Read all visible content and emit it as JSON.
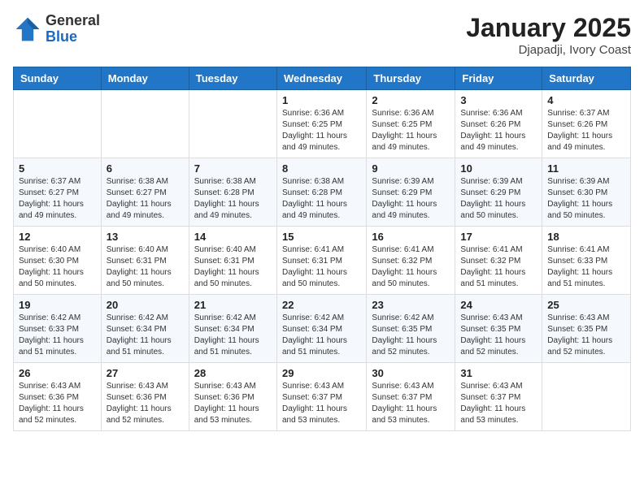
{
  "header": {
    "logo_general": "General",
    "logo_blue": "Blue",
    "month_title": "January 2025",
    "location": "Djapadji, Ivory Coast"
  },
  "weekdays": [
    "Sunday",
    "Monday",
    "Tuesday",
    "Wednesday",
    "Thursday",
    "Friday",
    "Saturday"
  ],
  "weeks": [
    [
      {
        "day": "",
        "info": ""
      },
      {
        "day": "",
        "info": ""
      },
      {
        "day": "",
        "info": ""
      },
      {
        "day": "1",
        "info": "Sunrise: 6:36 AM\nSunset: 6:25 PM\nDaylight: 11 hours and 49 minutes."
      },
      {
        "day": "2",
        "info": "Sunrise: 6:36 AM\nSunset: 6:25 PM\nDaylight: 11 hours and 49 minutes."
      },
      {
        "day": "3",
        "info": "Sunrise: 6:36 AM\nSunset: 6:26 PM\nDaylight: 11 hours and 49 minutes."
      },
      {
        "day": "4",
        "info": "Sunrise: 6:37 AM\nSunset: 6:26 PM\nDaylight: 11 hours and 49 minutes."
      }
    ],
    [
      {
        "day": "5",
        "info": "Sunrise: 6:37 AM\nSunset: 6:27 PM\nDaylight: 11 hours and 49 minutes."
      },
      {
        "day": "6",
        "info": "Sunrise: 6:38 AM\nSunset: 6:27 PM\nDaylight: 11 hours and 49 minutes."
      },
      {
        "day": "7",
        "info": "Sunrise: 6:38 AM\nSunset: 6:28 PM\nDaylight: 11 hours and 49 minutes."
      },
      {
        "day": "8",
        "info": "Sunrise: 6:38 AM\nSunset: 6:28 PM\nDaylight: 11 hours and 49 minutes."
      },
      {
        "day": "9",
        "info": "Sunrise: 6:39 AM\nSunset: 6:29 PM\nDaylight: 11 hours and 49 minutes."
      },
      {
        "day": "10",
        "info": "Sunrise: 6:39 AM\nSunset: 6:29 PM\nDaylight: 11 hours and 50 minutes."
      },
      {
        "day": "11",
        "info": "Sunrise: 6:39 AM\nSunset: 6:30 PM\nDaylight: 11 hours and 50 minutes."
      }
    ],
    [
      {
        "day": "12",
        "info": "Sunrise: 6:40 AM\nSunset: 6:30 PM\nDaylight: 11 hours and 50 minutes."
      },
      {
        "day": "13",
        "info": "Sunrise: 6:40 AM\nSunset: 6:31 PM\nDaylight: 11 hours and 50 minutes."
      },
      {
        "day": "14",
        "info": "Sunrise: 6:40 AM\nSunset: 6:31 PM\nDaylight: 11 hours and 50 minutes."
      },
      {
        "day": "15",
        "info": "Sunrise: 6:41 AM\nSunset: 6:31 PM\nDaylight: 11 hours and 50 minutes."
      },
      {
        "day": "16",
        "info": "Sunrise: 6:41 AM\nSunset: 6:32 PM\nDaylight: 11 hours and 50 minutes."
      },
      {
        "day": "17",
        "info": "Sunrise: 6:41 AM\nSunset: 6:32 PM\nDaylight: 11 hours and 51 minutes."
      },
      {
        "day": "18",
        "info": "Sunrise: 6:41 AM\nSunset: 6:33 PM\nDaylight: 11 hours and 51 minutes."
      }
    ],
    [
      {
        "day": "19",
        "info": "Sunrise: 6:42 AM\nSunset: 6:33 PM\nDaylight: 11 hours and 51 minutes."
      },
      {
        "day": "20",
        "info": "Sunrise: 6:42 AM\nSunset: 6:34 PM\nDaylight: 11 hours and 51 minutes."
      },
      {
        "day": "21",
        "info": "Sunrise: 6:42 AM\nSunset: 6:34 PM\nDaylight: 11 hours and 51 minutes."
      },
      {
        "day": "22",
        "info": "Sunrise: 6:42 AM\nSunset: 6:34 PM\nDaylight: 11 hours and 51 minutes."
      },
      {
        "day": "23",
        "info": "Sunrise: 6:42 AM\nSunset: 6:35 PM\nDaylight: 11 hours and 52 minutes."
      },
      {
        "day": "24",
        "info": "Sunrise: 6:43 AM\nSunset: 6:35 PM\nDaylight: 11 hours and 52 minutes."
      },
      {
        "day": "25",
        "info": "Sunrise: 6:43 AM\nSunset: 6:35 PM\nDaylight: 11 hours and 52 minutes."
      }
    ],
    [
      {
        "day": "26",
        "info": "Sunrise: 6:43 AM\nSunset: 6:36 PM\nDaylight: 11 hours and 52 minutes."
      },
      {
        "day": "27",
        "info": "Sunrise: 6:43 AM\nSunset: 6:36 PM\nDaylight: 11 hours and 52 minutes."
      },
      {
        "day": "28",
        "info": "Sunrise: 6:43 AM\nSunset: 6:36 PM\nDaylight: 11 hours and 53 minutes."
      },
      {
        "day": "29",
        "info": "Sunrise: 6:43 AM\nSunset: 6:37 PM\nDaylight: 11 hours and 53 minutes."
      },
      {
        "day": "30",
        "info": "Sunrise: 6:43 AM\nSunset: 6:37 PM\nDaylight: 11 hours and 53 minutes."
      },
      {
        "day": "31",
        "info": "Sunrise: 6:43 AM\nSunset: 6:37 PM\nDaylight: 11 hours and 53 minutes."
      },
      {
        "day": "",
        "info": ""
      }
    ]
  ]
}
